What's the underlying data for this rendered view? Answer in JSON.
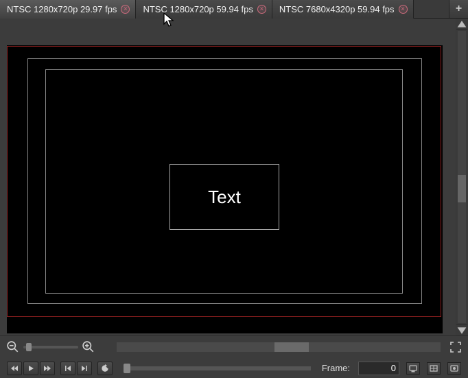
{
  "tabs": [
    {
      "label": "NTSC 1280x720p 29.97 fps",
      "active": true
    },
    {
      "label": "NTSC 1280x720p 59.94 fps",
      "active": false
    },
    {
      "label": "NTSC 7680x4320p 59.94 fps",
      "active": false
    }
  ],
  "canvas": {
    "text_content": "Text"
  },
  "footer": {
    "frame_label": "Frame:",
    "frame_value": "0"
  }
}
